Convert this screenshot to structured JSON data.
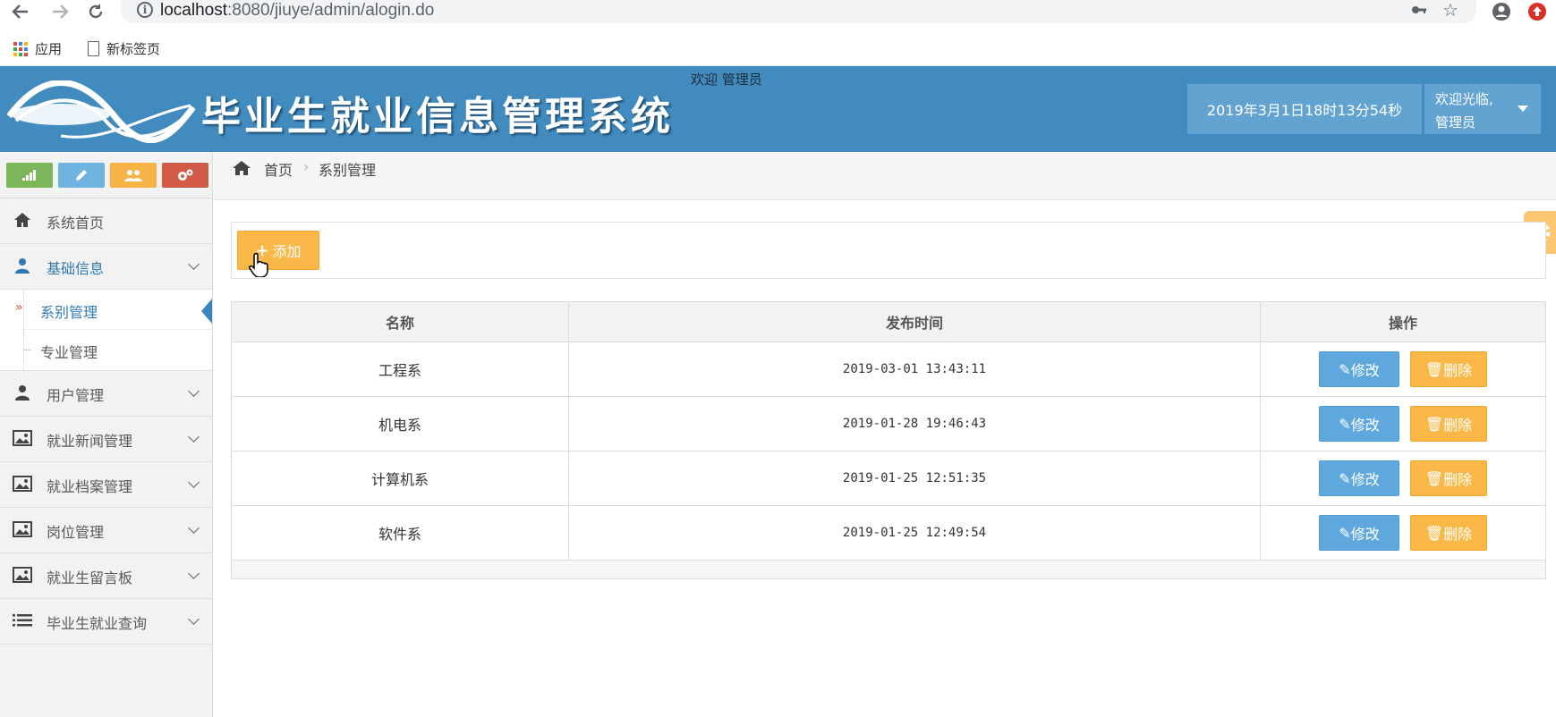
{
  "browser": {
    "url_host": "localhost",
    "url_rest": ":8080/jiuye/admin/alogin.do",
    "bookmarks": [
      "应用",
      "新标签页"
    ],
    "icons": [
      "back-icon",
      "forward-icon",
      "reload-icon",
      "info-icon",
      "key-icon",
      "star-icon",
      "account-icon",
      "update-icon"
    ]
  },
  "header": {
    "system_title": "毕业生就业信息管理系统",
    "welcome_admin": "欢迎 管理员",
    "datetime": "2019年3月1日18时13分54秒",
    "user_greeting": "欢迎光临,",
    "user_name": "管理员",
    "colors": {
      "header_bg": "#428bbf",
      "box_bg": "#62a3d1"
    }
  },
  "sidebar": {
    "shortcut_colors": [
      "#7cb65a",
      "#6fb3e0",
      "#f7b345",
      "#d15b47"
    ],
    "shortcut_icons": [
      "signal-icon",
      "pencil-icon",
      "users-icon",
      "cogs-icon"
    ],
    "items": [
      {
        "label": "系统首页",
        "icon": "home-icon"
      },
      {
        "label": "基础信息",
        "icon": "user-icon"
      },
      {
        "label": "用户管理",
        "icon": "user-icon"
      },
      {
        "label": "就业新闻管理",
        "icon": "picture-icon"
      },
      {
        "label": "就业档案管理",
        "icon": "picture-icon"
      },
      {
        "label": "岗位管理",
        "icon": "picture-icon"
      },
      {
        "label": "就业生留言板",
        "icon": "picture-icon"
      },
      {
        "label": "毕业生就业查询",
        "icon": "list-icon"
      }
    ],
    "submenu": [
      {
        "label": "系别管理",
        "active": true
      },
      {
        "label": "专业管理",
        "active": false
      }
    ]
  },
  "breadcrumb": {
    "home": "首页",
    "separator": "›",
    "current": "系别管理"
  },
  "toolbar": {
    "add_label": "添加"
  },
  "table": {
    "headers": [
      "名称",
      "发布时间",
      "操作"
    ],
    "rows": [
      {
        "name": "工程系",
        "time": "2019-03-01 13:43:11"
      },
      {
        "name": "机电系",
        "time": "2019-01-28 19:46:43"
      },
      {
        "name": "计算机系",
        "time": "2019-01-25 12:51:35"
      },
      {
        "name": "软件系",
        "time": "2019-01-25 12:49:54"
      }
    ],
    "edit_label": "修改",
    "delete_label": "删除"
  }
}
